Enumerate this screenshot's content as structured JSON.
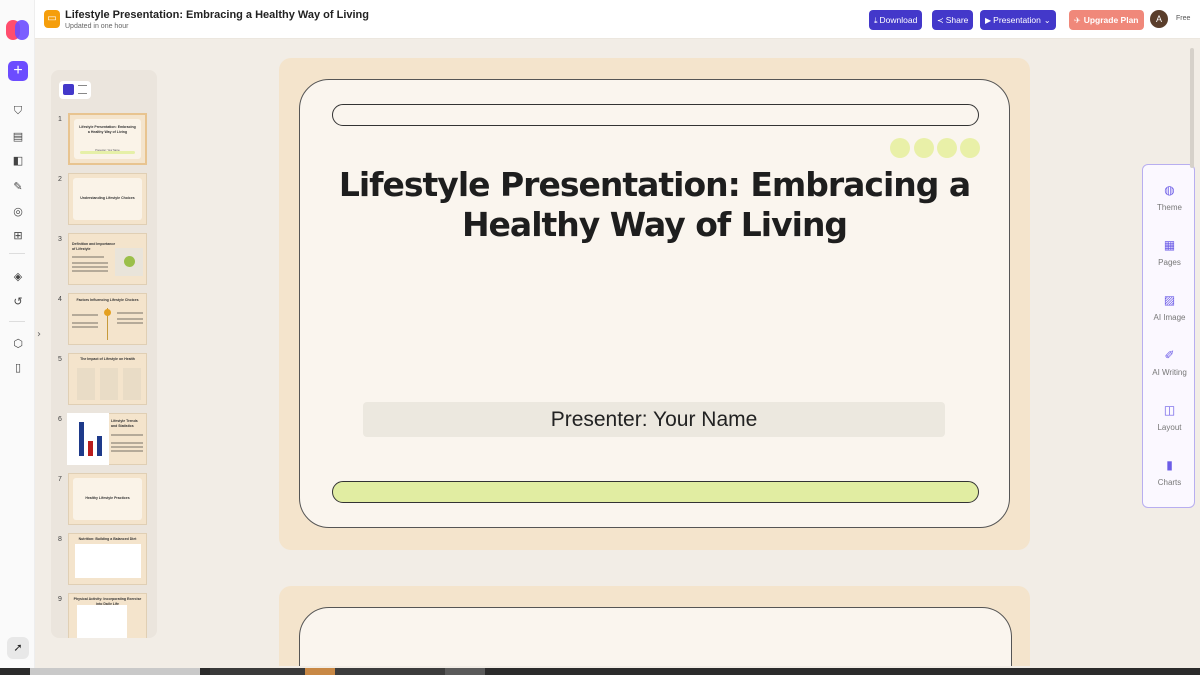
{
  "header": {
    "doc_title": "Lifestyle Presentation: Embracing a Healthy Way of Living",
    "doc_status": "Updated in one hour",
    "download_label": "Download",
    "share_label": "Share",
    "presentation_label": "Presentation",
    "upgrade_label": "Upgrade Plan",
    "avatar_initial": "A",
    "plan_label": "Free"
  },
  "slides_panel": {
    "thumbnails": [
      {
        "number": "1",
        "title": "Lifestyle Presentation: Embracing a Healthy Way of Living",
        "subtitle": "Presenter: Your Name"
      },
      {
        "number": "2",
        "title": "Understanding Lifestyle Choices"
      },
      {
        "number": "3",
        "title": "Definition and Importance of Lifestyle"
      },
      {
        "number": "4",
        "title": "Factors Influencing Lifestyle Choices"
      },
      {
        "number": "5",
        "title": "The Impact of Lifestyle on Health"
      },
      {
        "number": "6",
        "title": "Lifestyle Trends and Statistics"
      },
      {
        "number": "7",
        "title": "Healthy Lifestyle Practices"
      },
      {
        "number": "8",
        "title": "Nutrition: Building a Balanced Diet"
      },
      {
        "number": "9",
        "title": "Physical Activity: Incorporating Exercise into Daily Life"
      }
    ]
  },
  "slide": {
    "title": "Lifestyle Presentation: Embracing a Healthy Way of Living",
    "presenter": "Presenter: Your Name"
  },
  "tools": [
    {
      "label": "Theme",
      "icon": "palette-icon"
    },
    {
      "label": "Pages",
      "icon": "pages-icon"
    },
    {
      "label": "AI Image",
      "icon": "ai-image-icon"
    },
    {
      "label": "AI Writing",
      "icon": "ai-writing-icon"
    },
    {
      "label": "Layout",
      "icon": "layout-icon"
    },
    {
      "label": "Charts",
      "icon": "charts-icon"
    }
  ],
  "colors": {
    "accent": "#4338ca",
    "upgrade": "#f0887a",
    "slide_bg": "#f4e4cc",
    "card_bg": "#faf5ee",
    "lime": "#e1eda2"
  }
}
